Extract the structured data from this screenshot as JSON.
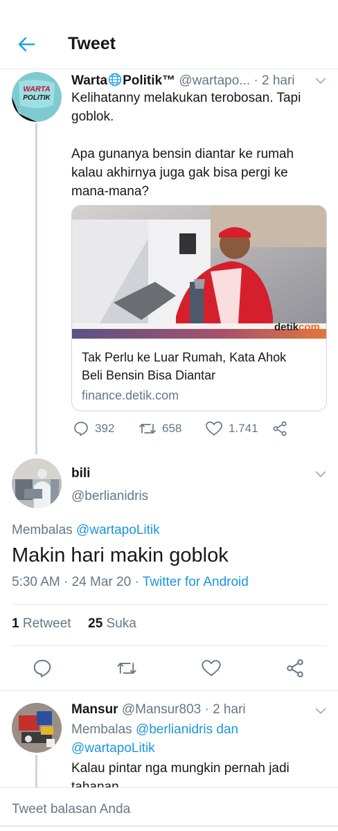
{
  "header": {
    "title": "Tweet"
  },
  "tweets": [
    {
      "display_name": "Warta Politik™",
      "name_part1": "Warta",
      "name_part2": "Politik™",
      "handle": "@wartapo...",
      "time": "· 2 hari",
      "text_line1": "Kelihatanny melakukan terobosan. Tapi",
      "text_line2": "goblok.",
      "text_line3": "Apa gunanya bensin diantar ke rumah",
      "text_line4": "kalau akhirnya juga gak bisa pergi ke",
      "text_line5": "mana-mana?",
      "avatar_text": [
        "WARTA",
        "POLITIK"
      ],
      "card": {
        "title_line1": "Tak Perlu ke Luar Rumah, Kata Ahok",
        "title_line2": "Beli Bensin Bisa Diantar",
        "domain": "finance.detik.com",
        "logo_a": "detik",
        "logo_b": "com"
      },
      "replies": "392",
      "retweets": "658",
      "likes": "1.741"
    },
    {
      "display_name": "bili",
      "handle": "@berlianidris",
      "reply_prefix": "Membalas",
      "reply_to": "@wartapoLitik",
      "text": "Makin hari makin goblok",
      "time": "5:30 AM",
      "date": "24 Mar 20",
      "source": "Twitter for Android",
      "retweet_count": "1",
      "retweet_label": "Retweet",
      "like_count": "25",
      "like_label": "Suka"
    },
    {
      "display_name": "Mansur",
      "handle": "@Mansur803",
      "time": "· 2 hari",
      "reply_prefix": "Membalas",
      "reply_to_1": "@berlianidris",
      "conj": "dan",
      "reply_to_2": "@wartapoLitik",
      "text_line1": "Kalau pintar nga mungkin pernah jadi",
      "text_line2": "tahanan"
    }
  ],
  "reply_box": {
    "placeholder": "Tweet balasan Anda"
  },
  "colors": {
    "accent": "#1da1f2",
    "link": "#1b95e0",
    "muted": "#657786",
    "border": "#e1e8ed"
  }
}
